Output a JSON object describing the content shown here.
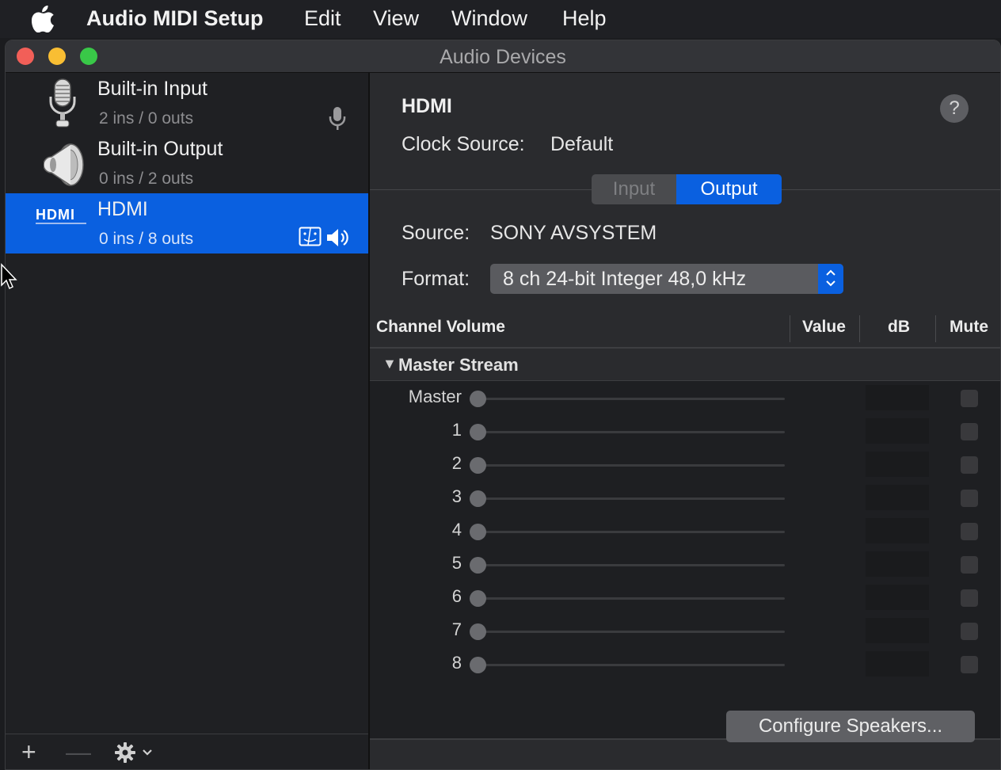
{
  "menubar": {
    "app_name": "Audio MIDI Setup",
    "items": [
      "Edit",
      "View",
      "Window",
      "Help"
    ]
  },
  "window": {
    "title": "Audio Devices"
  },
  "devices": [
    {
      "name": "Built-in Input",
      "io": "2 ins / 0 outs",
      "icon": "microphone-icon"
    },
    {
      "name": "Built-in Output",
      "io": "0 ins / 2 outs",
      "icon": "speaker-icon"
    },
    {
      "name": "HDMI",
      "io": "0 ins / 8 outs",
      "icon": "hdmi-icon",
      "selected": true,
      "logo_text": "HDMI"
    }
  ],
  "detail": {
    "device_name": "HDMI",
    "help": "?",
    "clock_label": "Clock Source:",
    "clock_value": "Default",
    "tabs": {
      "input": "Input",
      "output": "Output",
      "active": "Output"
    },
    "source_label": "Source:",
    "source_value": "SONY AVSYSTEM",
    "format_label": "Format:",
    "format_value": "8 ch 24-bit Integer 48,0 kHz"
  },
  "table": {
    "headers": {
      "channel": "Channel Volume",
      "value": "Value",
      "db": "dB",
      "mute": "Mute"
    },
    "group": "Master Stream",
    "channels": [
      "Master",
      "1",
      "2",
      "3",
      "4",
      "5",
      "6",
      "7",
      "8"
    ]
  },
  "configure_button": "Configure Speakers...",
  "sidebar_bottom": {
    "add": "+",
    "remove": "—"
  },
  "colors": {
    "accent": "#0a60e0",
    "close": "#f25f58",
    "minimize": "#f9be33",
    "zoom": "#39c848"
  }
}
